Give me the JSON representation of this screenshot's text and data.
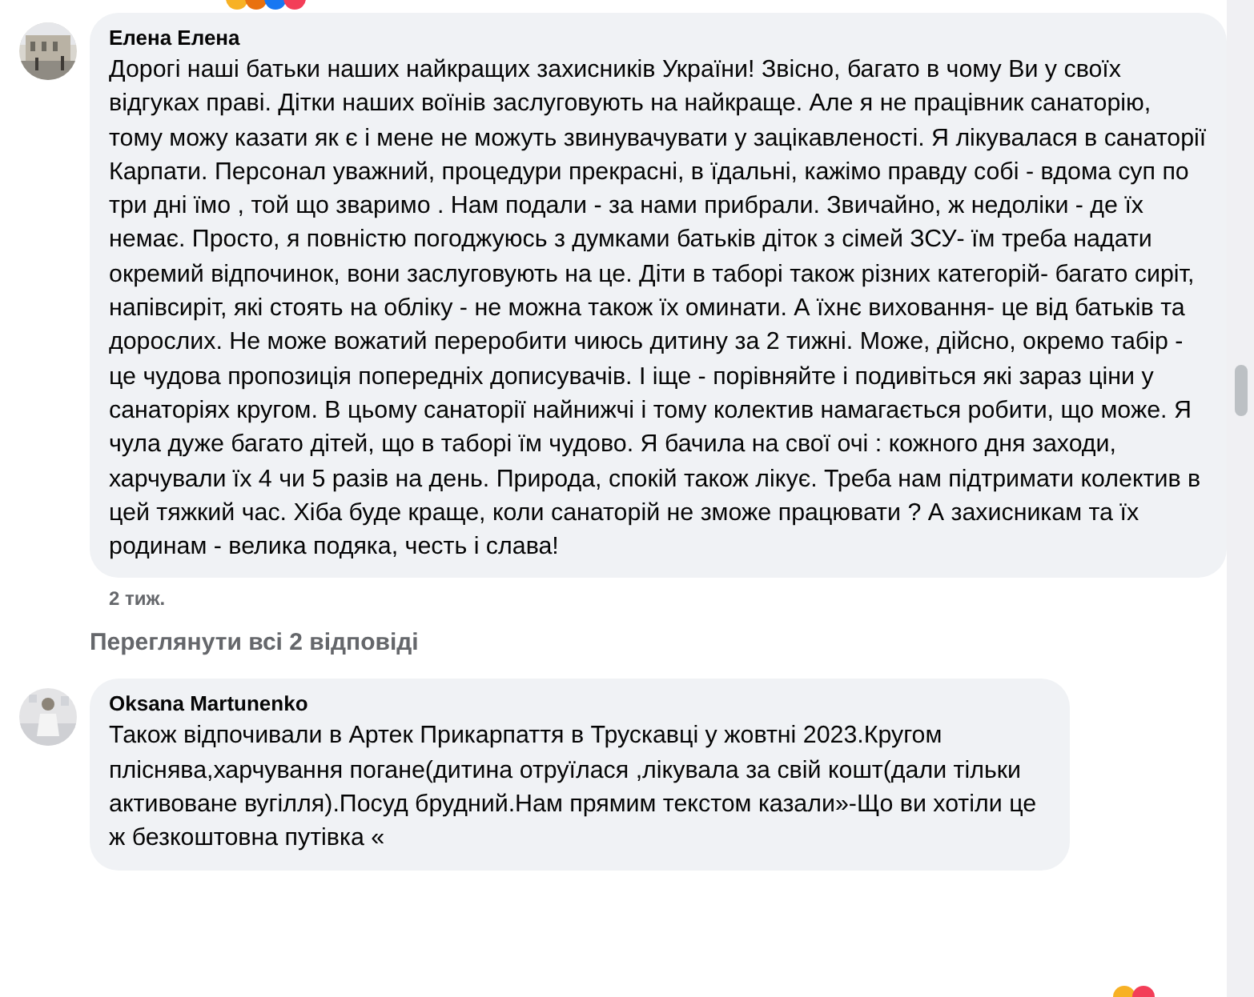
{
  "comments": [
    {
      "author": "Елена Елена",
      "text": "Дорогі наші батьки наших найкращих захисників України! Звісно, багато в чому Ви у своїх відгуках праві. Дітки наших воїнів заслуговують на найкраще. Але я не працівник санаторію, тому можу казати як є і мене не можуть звинувачувати у зацікавлeності. Я лікувалася в санаторії Карпати. Персонал уважний, процедури прекрасні, в їдальні, кажімо правду собі - вдома суп по три дні їмо , той що зваримо . Нам подали - за нами прибрали. Звичайно, ж недоліки - де їх немає. Просто, я повністю погоджуюсь з думками батьків діток з сімей ЗСУ- їм треба надати окремий відпочинок, вони заслуговують на це. Діти в таборі також різних категорій- багато сиріт, напівсиріт, які стоять на обліку - не можна також їх оминати. А їхнє виховання- це від батьків та дорослих. Не може вожатий переробити чиюсь дитину за 2 тижні. Може, дійсно, окремо табір - це чудова пропозиція попередніх дописувачів. І іще - порівняйте і подивіться які зараз ціни у санаторіях кругом. В цьому санаторії найнижчі і тому колектив намагається робити, що може. Я чула дуже багато дітей, що в таборі їм чудово. Я бачила на свої очі : кожного дня заходи, харчували їх 4 чи 5 разів на день. Природа, спокій також лікує. Треба нам підтримати колектив в цей тяжкий час. Хіба буде краще, коли санаторій не зможе працювати ? А захисникам та їх родинам - велика подяка, честь і слава!",
      "time": "2 тиж.",
      "replies_link": "Переглянути всі 2 відповіді"
    },
    {
      "author": "Oksana Martunenko",
      "text": "Також відпочивали в Артек Прикарпаття в Трускавці у жовтні 2023.Кругом пліснява,харчування погане(дитина отруїлася ,лікувала за свій кошт(дали тільки активоване вугілля).Посуд брудний.Нам прямим текстом казали»-Що ви хотіли це ж безкоштовна путівка «"
    }
  ]
}
